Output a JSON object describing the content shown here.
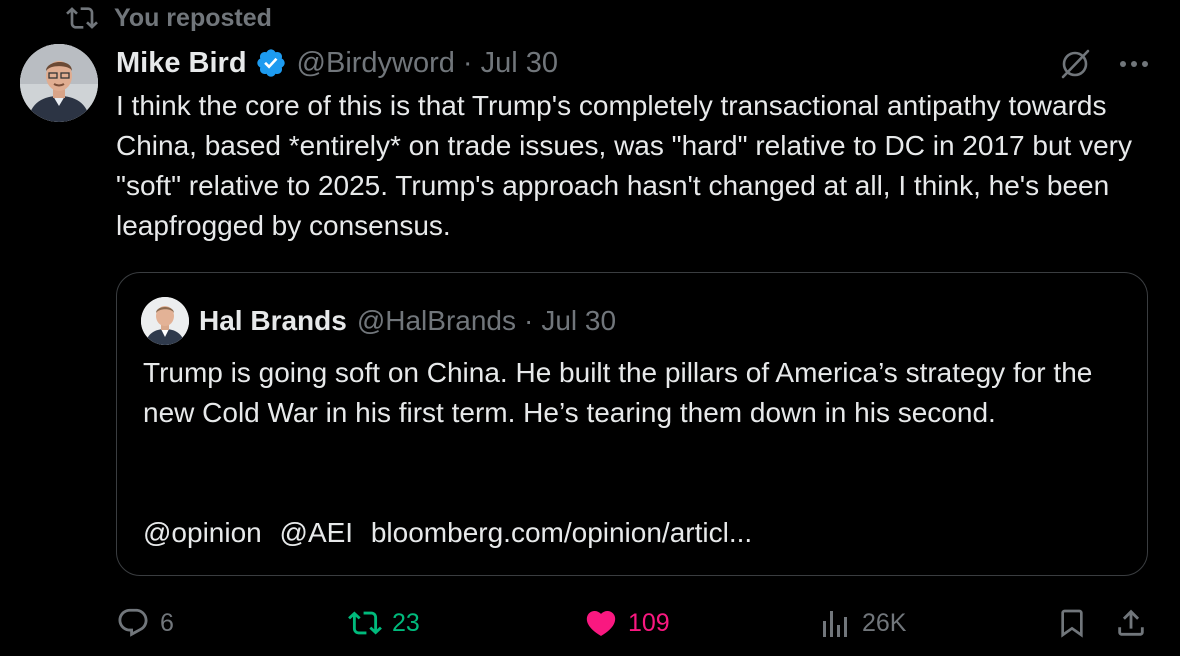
{
  "repost_banner": {
    "text": "You reposted",
    "icon": "repost-icon"
  },
  "author": {
    "name": "Mike Bird",
    "verified": true,
    "handle": "@Birdyword",
    "separator": "·",
    "date": "Jul 30",
    "avatar": "avatar-mike-bird"
  },
  "header_actions": {
    "grok_icon": "grok-icon",
    "more_icon": "more-icon"
  },
  "tweet": {
    "text": "I think the core of this is that Trump's completely transactional antipathy towards China, based *entirely* on trade issues, was \"hard\" relative to DC in 2017 but very \"soft\" relative to 2025. Trump's approach hasn't changed at all, I think, he's been leapfrogged by consensus."
  },
  "quote": {
    "name": "Hal Brands",
    "handle": "@HalBrands",
    "separator": "·",
    "date": "Jul 30",
    "text": "Trump is going soft on China. He built the pillars of America’s strategy for the new Cold War in his first term. He’s tearing them down in his second.",
    "mentions": [
      "@opinion",
      "@AEI"
    ],
    "link": "bloomberg.com/opinion/articl..."
  },
  "actions": {
    "replies": "6",
    "reposts": "23",
    "likes": "109",
    "views": "26K"
  },
  "colors": {
    "background": "#000000",
    "text": "#e7e9ea",
    "muted": "#71767b",
    "repost_active": "#00ba7c",
    "like_active": "#f91880",
    "verified": "#1d9bf0",
    "border": "#3a3d40"
  }
}
